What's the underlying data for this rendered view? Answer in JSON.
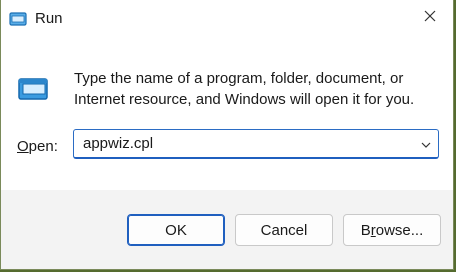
{
  "window": {
    "title": "Run",
    "close_glyph": "✕"
  },
  "dialog": {
    "description": "Type the name of a program, folder, document, or Internet resource, and Windows will open it for you.",
    "open_label_prefix": "O",
    "open_label_rest": "pen:",
    "input_value": "appwiz.cpl"
  },
  "buttons": {
    "ok_label": "OK",
    "cancel_label": "Cancel",
    "browse_prefix": "B",
    "browse_underlined": "r",
    "browse_rest": "owse..."
  },
  "colors": {
    "accent": "#1f5fbf",
    "footer_bg": "#f3f3f3",
    "background_outside": "#556b2f"
  },
  "icons": {
    "app_icon": "run-icon",
    "big_icon": "run-icon",
    "close_icon": "close-icon",
    "dropdown_icon": "chevron-down-icon"
  }
}
